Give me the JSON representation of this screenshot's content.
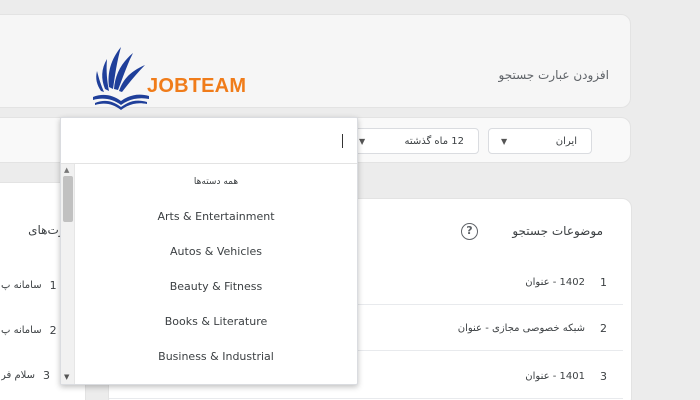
{
  "header": {
    "logo_text": "JOBTEAM",
    "title": "افزودن عبارت جستجو"
  },
  "filters": {
    "region": "ایران",
    "period": "12 ماه گذشته"
  },
  "dropdown": {
    "search_value": "",
    "items": [
      "همه دسته‌ها",
      "Arts & Entertainment",
      "Autos & Vehicles",
      "Beauty & Fitness",
      "Books & Literature",
      "Business & Industrial"
    ]
  },
  "left_panel": {
    "title": "عبارت‌های",
    "rows": [
      {
        "num": "1",
        "text": "سامانه پ"
      },
      {
        "num": "2",
        "text": "سامانه پ"
      },
      {
        "num": "3",
        "text": "سلام فر"
      }
    ]
  },
  "main_panel": {
    "title": "موضوعات جستجو",
    "rows": [
      {
        "num": "1",
        "text": "1402 - عنوان"
      },
      {
        "num": "2",
        "text": "شبکه خصوصی مجازی - عنوان"
      },
      {
        "num": "3",
        "text": "1401 - عنوان"
      }
    ]
  },
  "colors": {
    "logo_blue": "#1f3f9a",
    "logo_orange": "#f07c1a"
  }
}
